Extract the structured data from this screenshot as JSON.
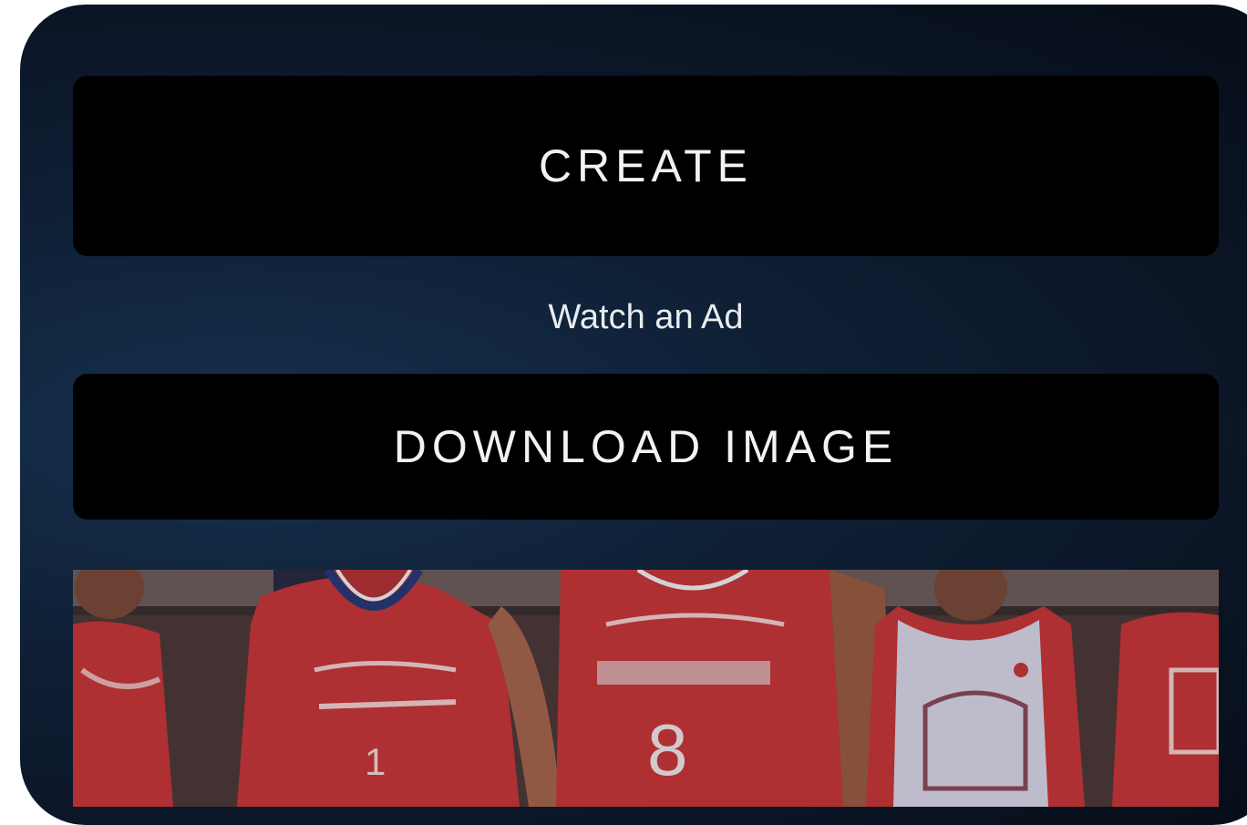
{
  "buttons": {
    "create_label": "CREATE",
    "download_label": "DOWNLOAD IMAGE"
  },
  "watch_ad": {
    "label": "Watch an Ad"
  },
  "preview": {
    "jersey_numbers": [
      "1",
      "8"
    ]
  },
  "colors": {
    "panel_bg": "#0f2036",
    "button_bg": "#000000",
    "button_text": "#f2f2f2",
    "jersey_red": "#c7373a"
  }
}
